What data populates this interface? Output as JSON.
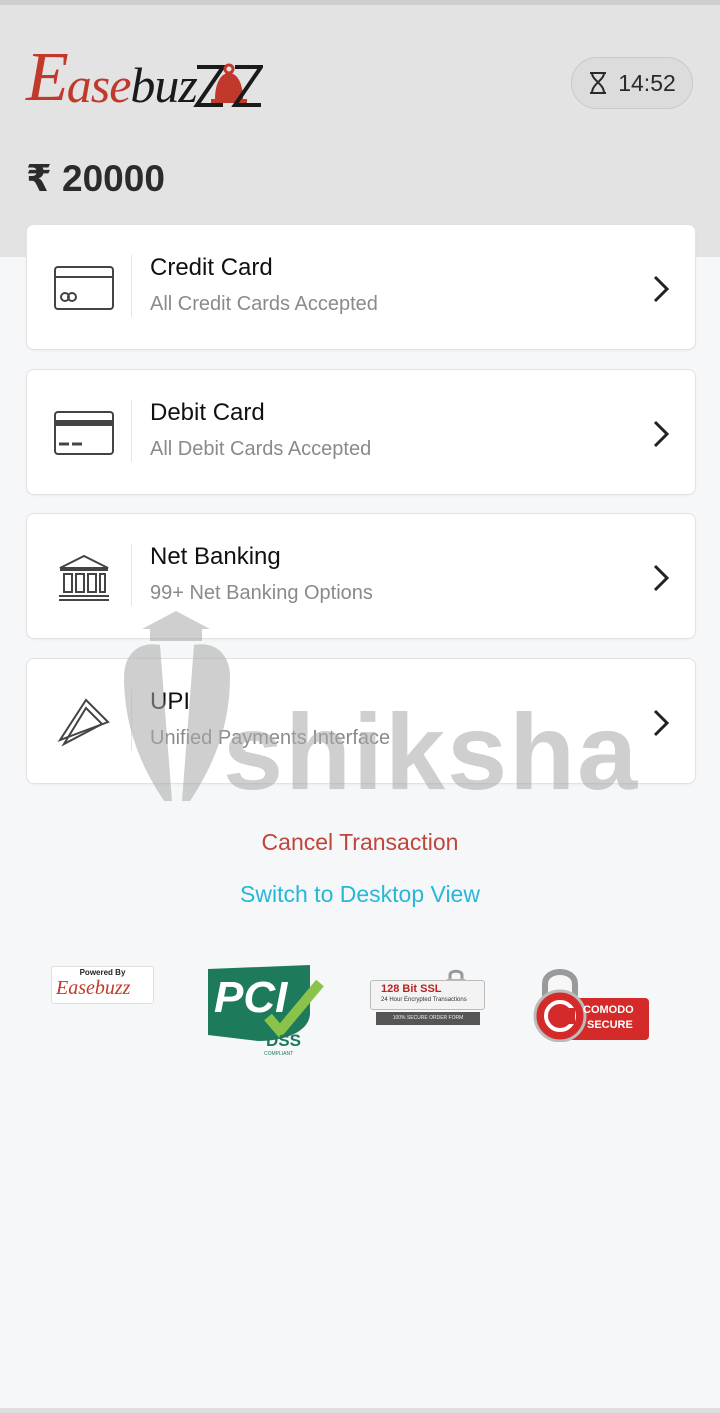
{
  "header": {
    "logo_e": "E",
    "logo_ase": "ase",
    "logo_buzz": "buz",
    "timer": "14:52",
    "amount": "₹ 20000"
  },
  "payment_methods": [
    {
      "title": "Credit Card",
      "subtitle": "All Credit Cards Accepted",
      "icon": "credit-card-icon"
    },
    {
      "title": "Debit Card",
      "subtitle": "All Debit Cards Accepted",
      "icon": "debit-card-icon"
    },
    {
      "title": "Net Banking",
      "subtitle": "99+ Net Banking Options",
      "icon": "bank-icon"
    },
    {
      "title": "UPI",
      "subtitle": "Unified Payments Interface",
      "icon": "upi-icon"
    }
  ],
  "actions": {
    "cancel": "Cancel Transaction",
    "desktop": "Switch to Desktop View"
  },
  "badges": {
    "powered_by": "Powered By",
    "powered_logo": "Easebuzz",
    "pci": "PCI",
    "dss": "DSS",
    "dss_sub": "COMPLIANT",
    "ssl_title": "128 Bit SSL",
    "ssl_sub": "24 Hour Encrypted Transactions",
    "ssl_foot": "100% SECURE ORDER FORM",
    "comodo_1": "COMODO",
    "comodo_2": "SECURE"
  },
  "watermark": {
    "text": "shiksha"
  },
  "colors": {
    "brand_red": "#c0392b",
    "link_blue": "#27b7d8",
    "cancel_red": "#c0453b",
    "header_bg": "#e3e3e3",
    "page_bg": "#f6f7f9"
  }
}
